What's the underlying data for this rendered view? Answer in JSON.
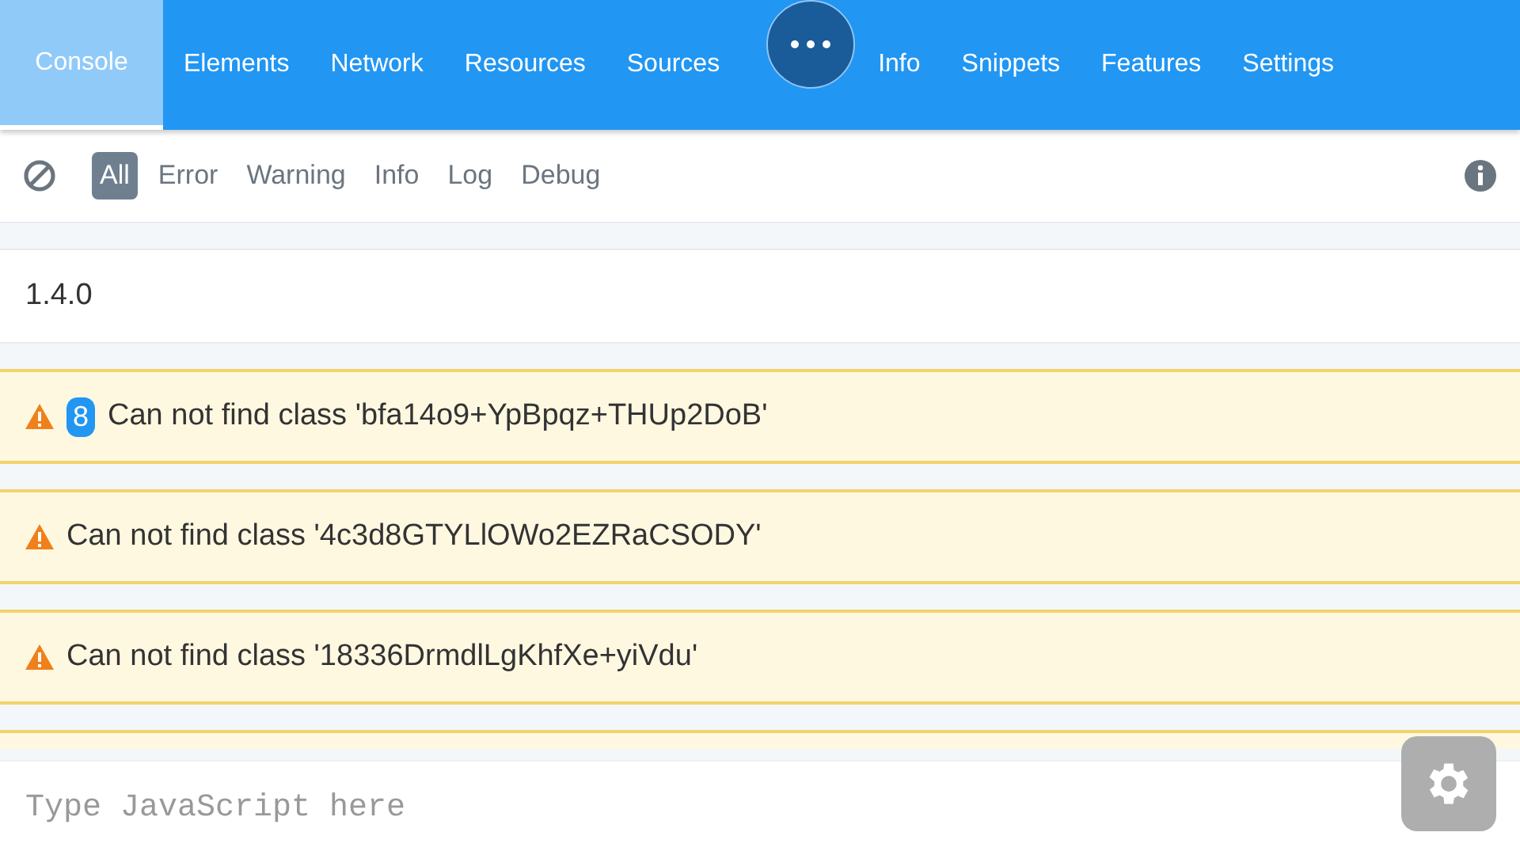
{
  "tabs": [
    {
      "label": "Console",
      "selected": true
    },
    {
      "label": "Elements",
      "selected": false
    },
    {
      "label": "Network",
      "selected": false
    },
    {
      "label": "Resources",
      "selected": false
    },
    {
      "label": "Sources",
      "selected": false
    },
    {
      "label": "Info",
      "selected": false
    },
    {
      "label": "Snippets",
      "selected": false
    },
    {
      "label": "Features",
      "selected": false
    },
    {
      "label": "Settings",
      "selected": false
    }
  ],
  "filters": [
    {
      "label": "All",
      "selected": true
    },
    {
      "label": "Error",
      "selected": false
    },
    {
      "label": "Warning",
      "selected": false
    },
    {
      "label": "Info",
      "selected": false
    },
    {
      "label": "Log",
      "selected": false
    },
    {
      "label": "Debug",
      "selected": false
    }
  ],
  "entries": [
    {
      "kind": "log",
      "text": "1.4.0"
    },
    {
      "kind": "warn",
      "count": "8",
      "text": "Can not find class 'bfa14o9+YpBpqz+THUp2DoB'"
    },
    {
      "kind": "warn",
      "text": "Can not find class '4c3d8GTYLlOWo2EZRaCSODY'"
    },
    {
      "kind": "warn",
      "text": "Can not find class '18336DrmdlLgKhfXe+yiVdu'"
    },
    {
      "kind": "warn-partial"
    }
  ],
  "input": {
    "placeholder": "Type JavaScript here"
  }
}
